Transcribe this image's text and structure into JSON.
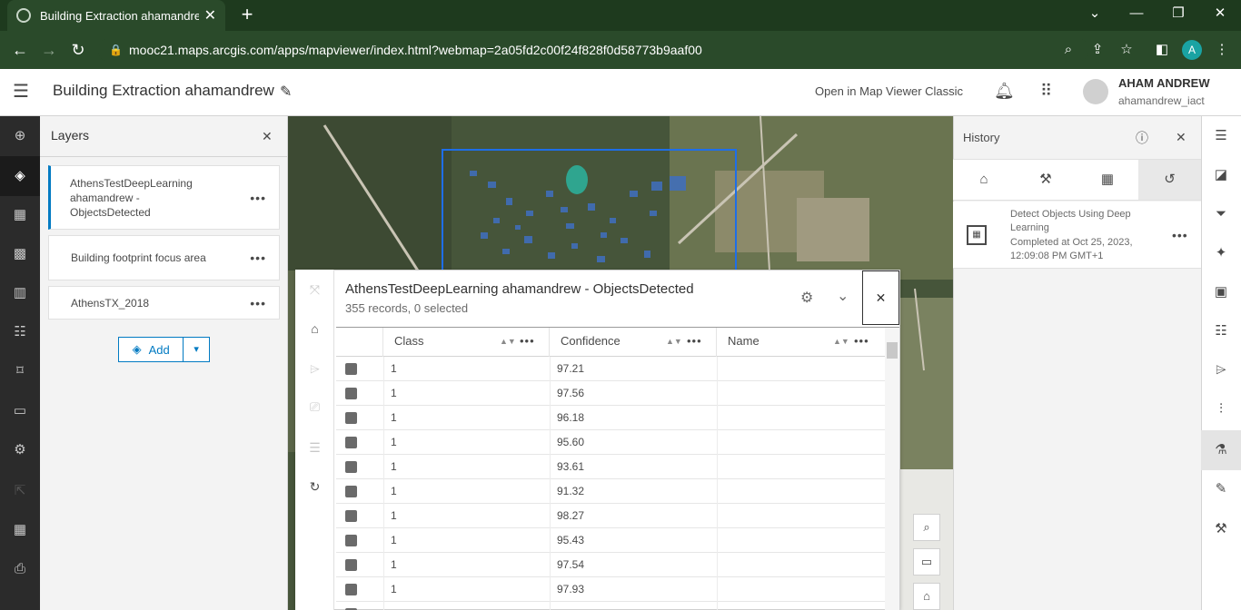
{
  "browser": {
    "tab_title": "Building Extraction ahamandrew",
    "new_tab": "+",
    "url": "mooc21.maps.arcgis.com/apps/mapviewer/index.html?webmap=2a05fd2c00f24f828f0d58773b9aaf00",
    "profile_initial": "A"
  },
  "header": {
    "map_title": "Building Extraction ahamandrew",
    "open_classic": "Open in Map Viewer Classic",
    "user_name": "AHAM ANDREW",
    "user_login": "ahamandrew_iact"
  },
  "layers_panel": {
    "title": "Layers",
    "items": [
      {
        "label": "AthensTestDeepLearning ahamandrew - ObjectsDetected",
        "selected": true
      },
      {
        "label": "Building footprint focus area",
        "selected": false
      },
      {
        "label": "AthensTX_2018",
        "selected": false
      }
    ],
    "add_label": "Add"
  },
  "table": {
    "title": "AthensTestDeepLearning ahamandrew - ObjectsDetected",
    "subtitle": "355 records, 0 selected",
    "columns": [
      "Class",
      "Confidence",
      "Name"
    ],
    "rows": [
      {
        "class": "1",
        "confidence": "97.21",
        "name": ""
      },
      {
        "class": "1",
        "confidence": "97.56",
        "name": ""
      },
      {
        "class": "1",
        "confidence": "96.18",
        "name": ""
      },
      {
        "class": "1",
        "confidence": "95.60",
        "name": ""
      },
      {
        "class": "1",
        "confidence": "93.61",
        "name": ""
      },
      {
        "class": "1",
        "confidence": "91.32",
        "name": ""
      },
      {
        "class": "1",
        "confidence": "98.27",
        "name": ""
      },
      {
        "class": "1",
        "confidence": "95.43",
        "name": ""
      },
      {
        "class": "1",
        "confidence": "97.54",
        "name": ""
      },
      {
        "class": "1",
        "confidence": "97.93",
        "name": ""
      }
    ]
  },
  "history": {
    "title": "History",
    "item_name": "Detect Objects Using Deep Learning",
    "item_status": "Completed at Oct 25, 2023, 12:09:08 PM GMT+1"
  },
  "colors": {
    "browser_dark": "#1e3a1e",
    "browser_bar": "#2a4a2a",
    "accent": "#007ac2",
    "left_toolbar": "#2b2b2b"
  }
}
